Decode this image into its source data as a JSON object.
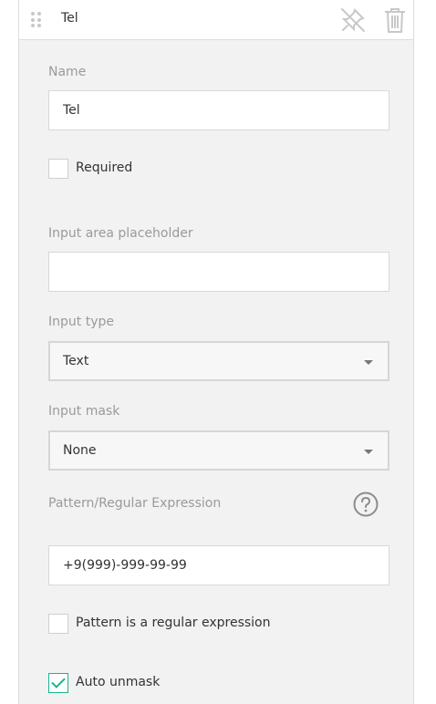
{
  "header": {
    "title": "Tel",
    "icons": [
      "drag-handle-icon",
      "unpin-icon",
      "trash-icon"
    ]
  },
  "fields": {
    "name": {
      "label": "Name",
      "value": "Tel"
    },
    "required": {
      "label": "Required",
      "checked": false
    },
    "placeholder": {
      "label": "Input area placeholder",
      "value": ""
    },
    "input_type": {
      "label": "Input type",
      "value": "Text"
    },
    "input_mask": {
      "label": "Input mask",
      "value": "None"
    },
    "pattern": {
      "label": "Pattern/Regular Expression",
      "value": "+9(999)-999-99-99",
      "help_icon": "question-circle-icon"
    },
    "pattern_is_regex": {
      "label": "Pattern is a regular expression",
      "checked": false
    },
    "auto_unmask": {
      "label": "Auto unmask",
      "checked": true
    }
  },
  "colors": {
    "panel_bg": "#f2f2f2",
    "accent": "#1ab394",
    "label": "#9a9a9a",
    "icon": "#c8c8c8"
  }
}
